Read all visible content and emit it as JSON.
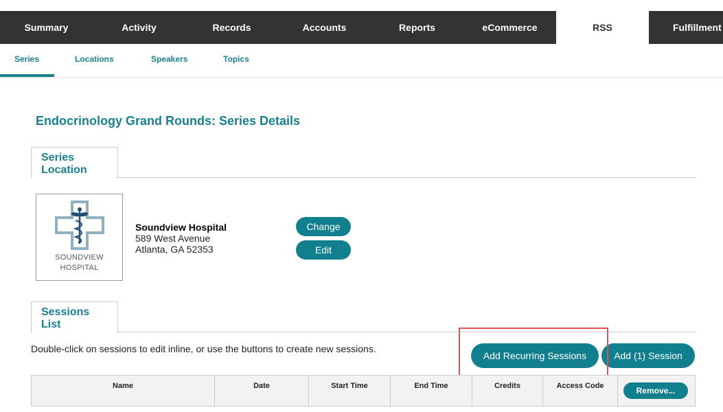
{
  "top_nav": {
    "tabs": [
      {
        "label": "Summary"
      },
      {
        "label": "Activity"
      },
      {
        "label": "Records"
      },
      {
        "label": "Accounts"
      },
      {
        "label": "Reports"
      },
      {
        "label": "eCommerce"
      },
      {
        "label": "RSS"
      },
      {
        "label": "Fulfillment"
      }
    ],
    "active": "RSS"
  },
  "sub_nav": {
    "items": [
      {
        "label": "Series"
      },
      {
        "label": "Locations"
      },
      {
        "label": "Speakers"
      },
      {
        "label": "Topics"
      }
    ],
    "active": "Series"
  },
  "page_title": "Endocrinology Grand Rounds: Series Details",
  "series_location": {
    "tab_line1": "Series",
    "tab_line2": "Location",
    "logo_line1": "SOUNDVIEW",
    "logo_line2": "HOSPITAL",
    "name": "Soundview Hospital",
    "address1": "589 West Avenue",
    "address2": "Atlanta, GA 52353",
    "change_label": "Change",
    "edit_label": "Edit"
  },
  "sessions_list": {
    "tab_line1": "Sessions",
    "tab_line2": "List",
    "help_text": "Double-click on sessions to edit inline, or use the buttons to create new sessions.",
    "add_recurring_label": "Add Recurring Sessions",
    "add_session_label": "Add (1) Session",
    "columns": [
      "Name",
      "Date",
      "Start Time",
      "End Time",
      "Credits",
      "Access Code"
    ],
    "remove_label": "Remove..."
  },
  "colors": {
    "accent": "#127f8f",
    "nav_bg": "#333333",
    "highlight": "#e05050"
  }
}
